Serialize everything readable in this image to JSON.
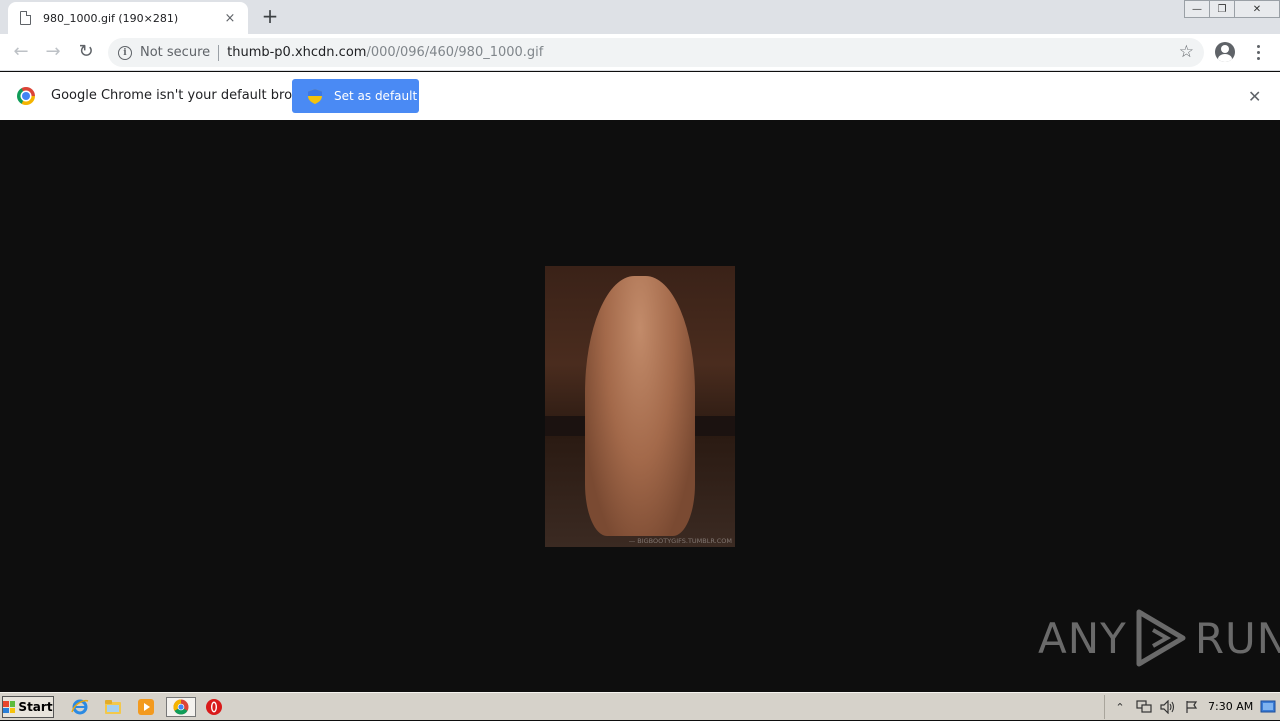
{
  "tab": {
    "title": "980_1000.gif (190×281)",
    "close_label": "×"
  },
  "newtab_label": "+",
  "window_controls": {
    "minimize": "—",
    "restore": "❐",
    "close": "✕"
  },
  "toolbar": {
    "back_label": "←",
    "forward_label": "→",
    "reload_label": "↻",
    "security_text": "Not secure",
    "url_host": "thumb-p0.xhcdn.com",
    "url_path": "/000/096/460/980_1000.gif",
    "star_label": "☆"
  },
  "infobar": {
    "message": "Google Chrome isn't your default browser",
    "button_label": "Set as default",
    "close_label": "✕"
  },
  "content": {
    "image_watermark": "— BIGBOOTYGIFS.TUMBLR.COM",
    "watermark_logo_left": "ANY",
    "watermark_logo_right": "RUN"
  },
  "taskbar": {
    "start_label": "Start",
    "clock": "7:30 AM"
  },
  "colors": {
    "accent": "#4a8af4",
    "content_bg": "#0e0e0e",
    "tabstrip_bg": "#dee1e6",
    "taskbar_bg": "#d6d2ca"
  },
  "icons": [
    "doc-icon",
    "close-icon",
    "plus-icon",
    "back-icon",
    "forward-icon",
    "reload-icon",
    "info-icon",
    "star-icon",
    "profile-icon",
    "menu-icon",
    "chrome-logo-icon",
    "shield-icon",
    "ie-icon",
    "folder-icon",
    "media-player-icon",
    "chrome-icon",
    "opera-icon",
    "tray-arrow-icon",
    "network-icon",
    "volume-icon",
    "flag-icon",
    "show-desktop-icon"
  ]
}
